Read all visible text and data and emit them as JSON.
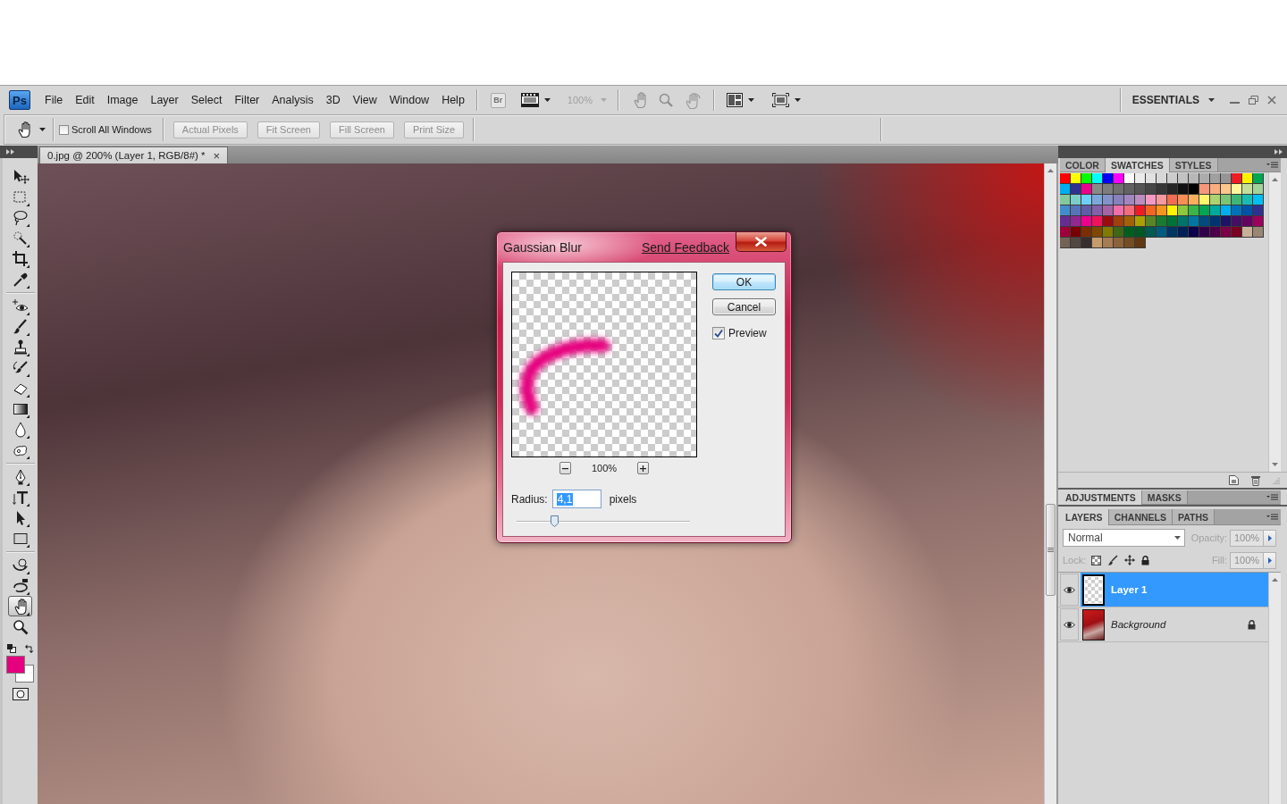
{
  "app": {
    "logo": "Ps",
    "menus": [
      "File",
      "Edit",
      "Image",
      "Layer",
      "Select",
      "Filter",
      "Analysis",
      "3D",
      "View",
      "Window",
      "Help"
    ],
    "bridge_button": "Br",
    "zoom_level": {
      "value": "100%",
      "disabled": true
    },
    "workspace": "ESSENTIALS"
  },
  "options_bar": {
    "scroll_all_windows": {
      "label": "Scroll All Windows",
      "checked": false
    },
    "buttons": [
      {
        "label": "Actual Pixels",
        "disabled": true
      },
      {
        "label": "Fit Screen",
        "disabled": true
      },
      {
        "label": "Fill Screen",
        "disabled": true
      },
      {
        "label": "Print Size",
        "disabled": true
      }
    ]
  },
  "toolbox": {
    "groups": [
      {
        "tools": [
          {
            "selected": false
          },
          {
            "selected": false
          },
          {
            "selected": false
          },
          {
            "selected": false
          },
          {
            "selected": false
          },
          {
            "selected": false
          }
        ]
      },
      {
        "tools": [
          {
            "selected": false
          },
          {
            "selected": false
          },
          {
            "selected": false
          },
          {
            "selected": false
          },
          {
            "selected": false
          },
          {
            "selected": false
          },
          {
            "selected": false
          },
          {
            "selected": false
          }
        ]
      },
      {
        "tools": [
          {
            "selected": false
          },
          {
            "selected": false
          },
          {
            "selected": false
          },
          {
            "selected": false
          }
        ]
      },
      {
        "tools": [
          {
            "selected": false
          },
          {
            "selected": false
          },
          {
            "selected": true
          },
          {
            "selected": false
          }
        ]
      }
    ],
    "colors": [
      {
        "kind": "foreground",
        "color": "#e4007f"
      },
      {
        "kind": "background",
        "color": "#ffffff"
      }
    ]
  },
  "document_tab": {
    "title": "0.jpg @ 200% (Layer 1, RGB/8#) *",
    "close": "×"
  },
  "dialog": {
    "title": "Gaussian Blur",
    "link": "Send Feedback",
    "preview_zoom": "100%",
    "buttons": [
      {
        "label": "OK",
        "default": true
      },
      {
        "label": "Cancel",
        "default": false
      }
    ],
    "preview": {
      "label": "Preview",
      "checked": true
    },
    "radius": {
      "label": "Radius:",
      "value": "4,1",
      "value_selected": true,
      "unit": "pixels",
      "level": 0.22
    }
  },
  "panels": {
    "color_group": {
      "tabs": [
        {
          "label": "COLOR",
          "selected": false
        },
        {
          "label": "SWATCHES",
          "selected": true
        },
        {
          "label": "STYLES",
          "selected": false
        }
      ],
      "swatches": [
        {
          "color": "#ff0000"
        },
        {
          "color": "#ffff00"
        },
        {
          "color": "#00ff00"
        },
        {
          "color": "#00ffff"
        },
        {
          "color": "#0000ff"
        },
        {
          "color": "#ff00ff"
        },
        {
          "color": "#ffffff"
        },
        {
          "color": "#ebebeb"
        },
        {
          "color": "#e1e1e1"
        },
        {
          "color": "#d7d7d7"
        },
        {
          "color": "#cccccc"
        },
        {
          "color": "#c2c2c2"
        },
        {
          "color": "#b7b7b7"
        },
        {
          "color": "#acacac"
        },
        {
          "color": "#a0a0a0"
        },
        {
          "color": "#959595"
        },
        {
          "color": "#ed1c24"
        },
        {
          "color": "#fff200"
        },
        {
          "color": "#00a651"
        },
        {
          "color": "#00aeef"
        },
        {
          "color": "#2e3192"
        },
        {
          "color": "#ec008c"
        },
        {
          "color": "#898989"
        },
        {
          "color": "#7d7d7d"
        },
        {
          "color": "#707070"
        },
        {
          "color": "#626262"
        },
        {
          "color": "#555555"
        },
        {
          "color": "#464646"
        },
        {
          "color": "#363636"
        },
        {
          "color": "#262626"
        },
        {
          "color": "#111111"
        },
        {
          "color": "#000000"
        },
        {
          "color": "#f7977a"
        },
        {
          "color": "#f9ad81"
        },
        {
          "color": "#fdc68a"
        },
        {
          "color": "#fff79a"
        },
        {
          "color": "#c4df9b"
        },
        {
          "color": "#a2d39c"
        },
        {
          "color": "#82ca9d"
        },
        {
          "color": "#7bcdc8"
        },
        {
          "color": "#6dcff6"
        },
        {
          "color": "#7da7d9"
        },
        {
          "color": "#8393ca"
        },
        {
          "color": "#8781bd"
        },
        {
          "color": "#a187be"
        },
        {
          "color": "#bc8dbf"
        },
        {
          "color": "#f49ac2"
        },
        {
          "color": "#f6989d"
        },
        {
          "color": "#f26c4f"
        },
        {
          "color": "#f68e56"
        },
        {
          "color": "#fbaf5d"
        },
        {
          "color": "#fff568"
        },
        {
          "color": "#acd372"
        },
        {
          "color": "#7cc576"
        },
        {
          "color": "#3bb878"
        },
        {
          "color": "#1abbb4"
        },
        {
          "color": "#00bff3"
        },
        {
          "color": "#438ccb"
        },
        {
          "color": "#5574b9"
        },
        {
          "color": "#605ca8"
        },
        {
          "color": "#855fa8"
        },
        {
          "color": "#a763a8"
        },
        {
          "color": "#f06ea9"
        },
        {
          "color": "#f26d7d"
        },
        {
          "color": "#ed1c24"
        },
        {
          "color": "#f26522"
        },
        {
          "color": "#f7941d"
        },
        {
          "color": "#fff200"
        },
        {
          "color": "#8dc63f"
        },
        {
          "color": "#39b54a"
        },
        {
          "color": "#00a651"
        },
        {
          "color": "#00a99d"
        },
        {
          "color": "#00aeef"
        },
        {
          "color": "#0072bc"
        },
        {
          "color": "#0054a6"
        },
        {
          "color": "#2e3192"
        },
        {
          "color": "#662d91"
        },
        {
          "color": "#92278f"
        },
        {
          "color": "#ec008c"
        },
        {
          "color": "#ed145b"
        },
        {
          "color": "#9e0b0f"
        },
        {
          "color": "#a0410d"
        },
        {
          "color": "#a36209"
        },
        {
          "color": "#aba000"
        },
        {
          "color": "#598527"
        },
        {
          "color": "#197b30"
        },
        {
          "color": "#007236"
        },
        {
          "color": "#00746b"
        },
        {
          "color": "#0076a3"
        },
        {
          "color": "#004b80"
        },
        {
          "color": "#003471"
        },
        {
          "color": "#1b1464"
        },
        {
          "color": "#440e62"
        },
        {
          "color": "#630460"
        },
        {
          "color": "#9e005d"
        },
        {
          "color": "#9e0039"
        },
        {
          "color": "#790000"
        },
        {
          "color": "#7b2e00"
        },
        {
          "color": "#7d4900"
        },
        {
          "color": "#827b00"
        },
        {
          "color": "#406618"
        },
        {
          "color": "#005e20"
        },
        {
          "color": "#005826"
        },
        {
          "color": "#005952"
        },
        {
          "color": "#005b7f"
        },
        {
          "color": "#003663"
        },
        {
          "color": "#002157"
        },
        {
          "color": "#0d004c"
        },
        {
          "color": "#32004b"
        },
        {
          "color": "#4b0049"
        },
        {
          "color": "#7b0046"
        },
        {
          "color": "#7a0026"
        },
        {
          "color": "#c7b299"
        },
        {
          "color": "#998675"
        },
        {
          "color": "#736357"
        },
        {
          "color": "#534741"
        },
        {
          "color": "#362f2d"
        },
        {
          "color": "#c69c6d"
        },
        {
          "color": "#a67c52"
        },
        {
          "color": "#8c6239"
        },
        {
          "color": "#754c24"
        },
        {
          "color": "#603913"
        }
      ]
    },
    "adjustments_group": {
      "tabs": [
        {
          "label": "ADJUSTMENTS",
          "selected": true
        },
        {
          "label": "MASKS",
          "selected": false
        }
      ]
    },
    "layers_group": {
      "tabs": [
        {
          "label": "LAYERS",
          "selected": true
        },
        {
          "label": "CHANNELS",
          "selected": false
        },
        {
          "label": "PATHS",
          "selected": false
        }
      ],
      "blend_mode": "Normal",
      "options_disabled": true,
      "opacity": {
        "label": "Opacity:",
        "value": "100%"
      },
      "lock_label": "Lock:",
      "fill": {
        "label": "Fill:",
        "value": "100%"
      },
      "layers": [
        {
          "name": "Layer 1",
          "kind": "layer",
          "selected": true,
          "visible": true,
          "locked": false
        },
        {
          "name": "Background",
          "kind": "background",
          "selected": false,
          "visible": true,
          "locked": true
        }
      ]
    }
  }
}
